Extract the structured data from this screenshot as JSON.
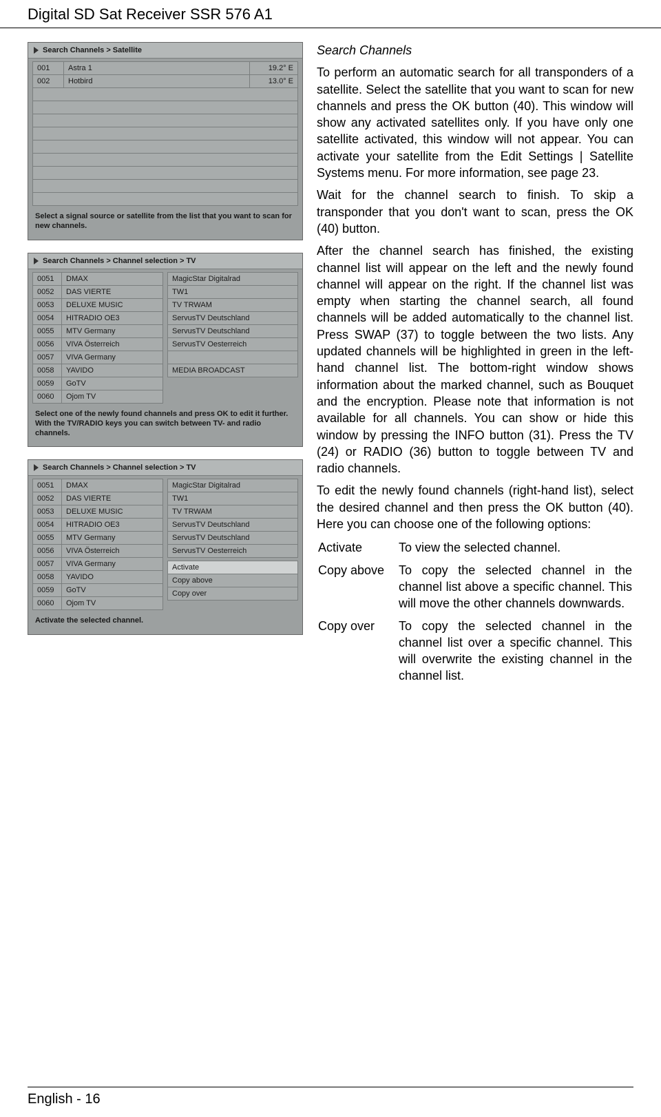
{
  "header": "Digital SD Sat Receiver SSR 576 A1",
  "footer": "English  -  16",
  "section_title": "Search Channels",
  "paras": {
    "p1": "To perform an automatic search for all transponders of a satellite. Select the satellite that you want to scan for new channels and press the OK button (40). This window will show any activated satellites only. If you have only one satellite activated, this window will not appear. You can activate your satellite from the Edit Settings | Satellite Systems menu. For more information, see page 23.",
    "p2": "Wait for the channel search to finish. To skip a transponder that you don't want to scan, press the OK (40) button.",
    "p3": "After the channel search has finished, the existing channel list will appear on the left and the newly found channel will appear on the right. If the channel list was empty when starting the channel search, all found channels will be added automatically to the channel list. Press SWAP (37) to toggle between the two lists. Any updated channels will be highlighted in green in the left-hand channel list. The bottom-right window shows information about the marked channel, such as Bouquet and the encryption. Please note that information is not available for all channels. You can show or hide this window by pressing the INFO button (31). Press the TV (24) or RADIO (36) button to toggle between TV and radio channels.",
    "p4": "To edit the newly found channels (right-hand list), select the desired channel and then press the OK button (40). Here you can choose one of the following options:"
  },
  "options": [
    {
      "name": "Activate",
      "desc": "To view the selected channel."
    },
    {
      "name": "Copy above",
      "desc": "To copy the selected channel in the channel list above a specific channel. This will move the other channels downwards."
    },
    {
      "name": "Copy over",
      "desc": "To copy the selected channel in the channel list over a specific channel. This will overwrite the existing channel in the channel list."
    }
  ],
  "fig1": {
    "crumb": "Search Channels > Satellite",
    "rows": [
      {
        "num": "001",
        "name": "Astra 1",
        "pos": "19.2° E"
      },
      {
        "num": "002",
        "name": "Hotbird",
        "pos": "13.0° E"
      }
    ],
    "blank_rows": 9,
    "hint": "Select a signal source or satellite from the list that you want to scan for new channels."
  },
  "fig2": {
    "crumb": "Search Channels > Channel selection > TV",
    "left": [
      {
        "num": "0051",
        "name": "DMAX"
      },
      {
        "num": "0052",
        "name": "DAS VIERTE"
      },
      {
        "num": "0053",
        "name": "DELUXE MUSIC"
      },
      {
        "num": "0054",
        "name": "HITRADIO OE3"
      },
      {
        "num": "0055",
        "name": "MTV Germany"
      },
      {
        "num": "0056",
        "name": "VIVA Österreich"
      },
      {
        "num": "0057",
        "name": "VIVA Germany"
      },
      {
        "num": "0058",
        "name": "YAVIDO"
      },
      {
        "num": "0059",
        "name": "GoTV"
      },
      {
        "num": "0060",
        "name": "Ojom TV"
      }
    ],
    "right": [
      "MagicStar Digitalrad",
      "TW1",
      "TV TRWAM",
      "ServusTV Deutschland",
      "ServusTV Deutschland",
      "ServusTV Oesterreich",
      "",
      "MEDIA BROADCAST"
    ],
    "hint": "Select one of the newly found channels and press OK to edit it further. With the TV/RADIO keys you can switch between TV- and radio channels."
  },
  "fig3": {
    "crumb": "Search Channels > Channel selection > TV",
    "left": [
      {
        "num": "0051",
        "name": "DMAX"
      },
      {
        "num": "0052",
        "name": "DAS VIERTE"
      },
      {
        "num": "0053",
        "name": "DELUXE MUSIC"
      },
      {
        "num": "0054",
        "name": "HITRADIO OE3"
      },
      {
        "num": "0055",
        "name": "MTV Germany"
      },
      {
        "num": "0056",
        "name": "VIVA Österreich"
      },
      {
        "num": "0057",
        "name": "VIVA Germany"
      },
      {
        "num": "0058",
        "name": "YAVIDO"
      },
      {
        "num": "0059",
        "name": "GoTV"
      },
      {
        "num": "0060",
        "name": "Ojom TV"
      }
    ],
    "right": [
      "MagicStar Digitalrad",
      "TW1",
      "TV TRWAM",
      "ServusTV Deutschland",
      "ServusTV Deutschland",
      "ServusTV Oesterreich"
    ],
    "context": [
      "Activate",
      "Copy above",
      "Copy over"
    ],
    "context_selected": 0,
    "hint": "Activate the selected channel."
  }
}
